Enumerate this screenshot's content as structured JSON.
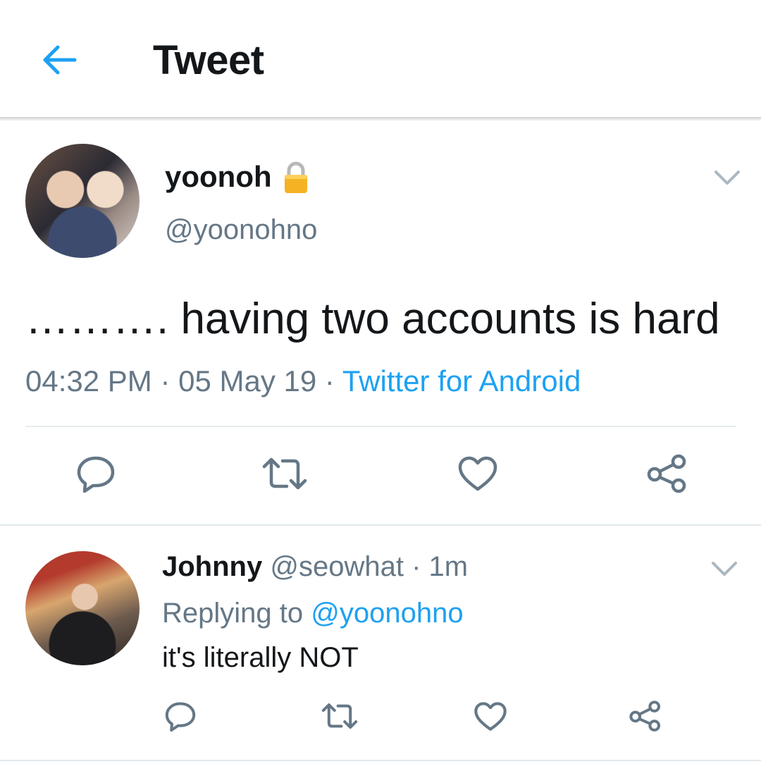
{
  "header": {
    "title": "Tweet"
  },
  "colors": {
    "accent": "#1da1f2",
    "secondary_text": "#657786",
    "primary_text": "#14171a",
    "divider": "#e1e8ed"
  },
  "main_tweet": {
    "display_name": "yoonoh",
    "handle": "@yoonohno",
    "protected_icon": "lock-icon",
    "text": "………. having two accounts is hard",
    "time": "04:32 PM",
    "separator": "·",
    "date": "05 May 19",
    "source": "Twitter for Android",
    "actions": [
      "reply-icon",
      "retweet-icon",
      "like-icon",
      "share-icon"
    ]
  },
  "reply_tweet": {
    "display_name": "Johnny",
    "handle": "@seowhat",
    "separator": "·",
    "age": "1m",
    "replying_prefix": "Replying to",
    "replying_to": "@yoonohno",
    "text": "it's literally NOT",
    "actions": [
      "reply-icon",
      "retweet-icon",
      "like-icon",
      "share-icon"
    ]
  }
}
